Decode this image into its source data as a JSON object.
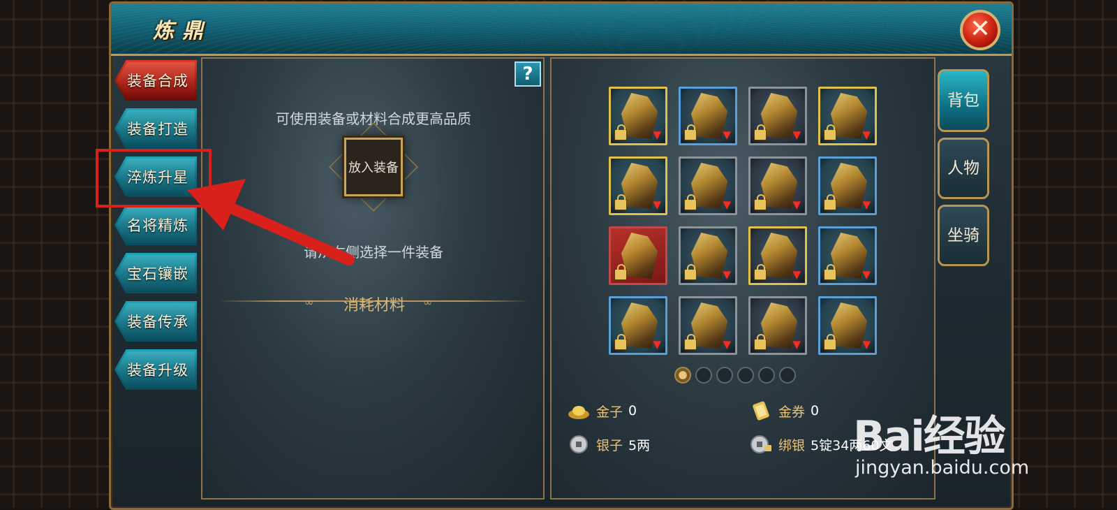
{
  "window": {
    "title": "炼鼎",
    "close_icon": "close-icon"
  },
  "left_tabs": [
    {
      "label": "装备合成",
      "active": true
    },
    {
      "label": "装备打造",
      "active": false
    },
    {
      "label": "淬炼升星",
      "active": false
    },
    {
      "label": "名将精炼",
      "active": false
    },
    {
      "label": "宝石镶嵌",
      "active": false
    },
    {
      "label": "装备传承",
      "active": false
    },
    {
      "label": "装备升级",
      "active": false
    }
  ],
  "compose_panel": {
    "help_label": "?",
    "hint_top": "可使用装备或材料合成更高品质",
    "slot_label": "放入装备",
    "hint_bottom": "请从右侧选择一件装备",
    "materials_label": "消耗材料"
  },
  "inventory": {
    "rows": 4,
    "cols": 4,
    "items": [
      {
        "frame": "gold",
        "locked": true,
        "downgrade": true
      },
      {
        "frame": "blue",
        "locked": true,
        "downgrade": true
      },
      {
        "frame": "gray",
        "locked": true,
        "downgrade": true
      },
      {
        "frame": "gold",
        "locked": true,
        "downgrade": true
      },
      {
        "frame": "gold",
        "locked": true,
        "downgrade": true
      },
      {
        "frame": "gray",
        "locked": true,
        "downgrade": true
      },
      {
        "frame": "gray",
        "locked": true,
        "downgrade": true
      },
      {
        "frame": "blue",
        "locked": true,
        "downgrade": true
      },
      {
        "frame": "red",
        "locked": true,
        "downgrade": false
      },
      {
        "frame": "gray",
        "locked": true,
        "downgrade": true
      },
      {
        "frame": "gold",
        "locked": true,
        "downgrade": true
      },
      {
        "frame": "blue",
        "locked": true,
        "downgrade": true
      },
      {
        "frame": "blue",
        "locked": true,
        "downgrade": true
      },
      {
        "frame": "gray",
        "locked": true,
        "downgrade": true
      },
      {
        "frame": "gray",
        "locked": true,
        "downgrade": true
      },
      {
        "frame": "blue",
        "locked": true,
        "downgrade": true
      }
    ],
    "pages": 6,
    "current_page": 1
  },
  "currencies": {
    "gold": {
      "label": "金子",
      "value": "0",
      "icon": "gold-ingot-icon"
    },
    "coupon": {
      "label": "金券",
      "value": "0",
      "icon": "coupon-scroll-icon"
    },
    "silver": {
      "label": "银子",
      "value": "5两",
      "icon": "silver-coin-icon"
    },
    "bound_silver": {
      "label": "绑银",
      "value": "5锭34两60文",
      "icon": "bound-silver-icon"
    }
  },
  "side_tabs": [
    {
      "label": "背包",
      "active": true
    },
    {
      "label": "人物",
      "active": false
    },
    {
      "label": "坐骑",
      "active": false
    }
  ],
  "watermark": {
    "main": "Bai经验",
    "url": "jingyan.baidu.com"
  },
  "colors": {
    "tab_active": "#c8200e",
    "tab_normal": "#0c6f82",
    "annotation": "#d8211a",
    "gold_text": "#e6c27a"
  }
}
